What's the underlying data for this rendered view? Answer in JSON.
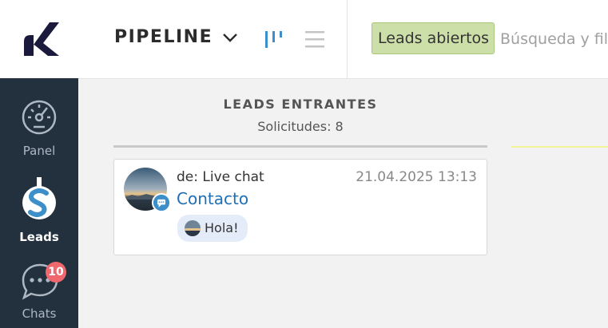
{
  "header": {
    "pipeline_label": "PIPELINE",
    "filter_chip": "Leads abiertos",
    "search_placeholder": "Búsqueda y filtro"
  },
  "sidebar": {
    "items": [
      {
        "label": "Panel",
        "icon": "dashboard-gauge-icon",
        "active": false
      },
      {
        "label": "Leads",
        "icon": "dollar-icon",
        "active": true
      },
      {
        "label": "Chats",
        "icon": "chat-bubble-icon",
        "active": false,
        "badge": "10"
      }
    ]
  },
  "column": {
    "title": "LEADS ENTRANTES",
    "subtitle": "Solicitudes: 8"
  },
  "card": {
    "from": "de: Live chat",
    "date": "21.04.2025 13:13",
    "contact": "Contacto",
    "message": "Hola!",
    "channel_icon": "chat-channel-icon"
  },
  "colors": {
    "sidebar_bg": "#23313e",
    "accent_blue": "#3c8fc9",
    "filter_chip_bg": "#ccdfa8",
    "badge_red": "#f0686e",
    "link_blue": "#1f6fb5"
  }
}
